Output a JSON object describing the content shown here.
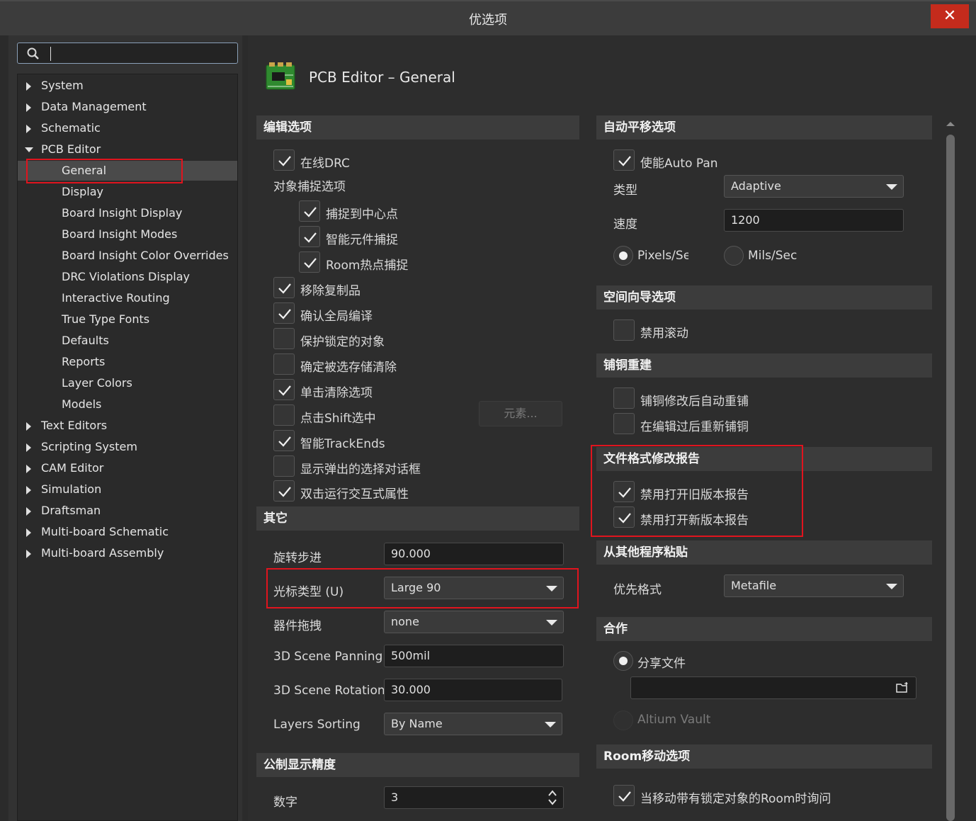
{
  "window": {
    "title": "优选项",
    "close_label": "✕"
  },
  "search": {
    "placeholder": ""
  },
  "tree": [
    {
      "label": "System",
      "expandable": true
    },
    {
      "label": "Data Management",
      "expandable": true
    },
    {
      "label": "Schematic",
      "expandable": true
    },
    {
      "label": "PCB Editor",
      "expanded": true
    },
    {
      "label": "General",
      "selected": true
    },
    {
      "label": "Display"
    },
    {
      "label": "Board Insight Display"
    },
    {
      "label": "Board Insight Modes"
    },
    {
      "label": "Board Insight Color Overrides"
    },
    {
      "label": "DRC Violations Display"
    },
    {
      "label": "Interactive Routing"
    },
    {
      "label": "True Type Fonts"
    },
    {
      "label": "Defaults"
    },
    {
      "label": "Reports"
    },
    {
      "label": "Layer Colors"
    },
    {
      "label": "Models"
    },
    {
      "label": "Text Editors",
      "expandable": true
    },
    {
      "label": "Scripting System",
      "expandable": true
    },
    {
      "label": "CAM Editor",
      "expandable": true
    },
    {
      "label": "Simulation",
      "expandable": true
    },
    {
      "label": "Draftsman",
      "expandable": true
    },
    {
      "label": "Multi-board Schematic",
      "expandable": true
    },
    {
      "label": "Multi-board Assembly",
      "expandable": true
    }
  ],
  "page": {
    "title": "PCB Editor – General"
  },
  "edit_options": {
    "heading": "编辑选项",
    "online_drc": {
      "label": "在线DRC",
      "checked": true
    },
    "snap_heading": "对象捕捉选项",
    "snap_center": {
      "label": "捕捉到中心点",
      "checked": true
    },
    "smart_component_snap": {
      "label": "智能元件捕捉",
      "checked": true
    },
    "room_hotspot": {
      "label": "Room热点捕捉",
      "checked": true
    },
    "remove_duplicates": {
      "label": "移除复制品",
      "checked": true
    },
    "confirm_global_edit": {
      "label": "确认全局编译",
      "checked": true
    },
    "protect_locked": {
      "label": "保护锁定的对象",
      "checked": false
    },
    "confirm_clear_selection": {
      "label": "确定被选存储清除",
      "checked": false
    },
    "click_clear_selection": {
      "label": "单击清除选项",
      "checked": true
    },
    "shift_click_select": {
      "label": "点击Shift选中",
      "checked": false
    },
    "elements_button": "元素...",
    "smart_track_ends": {
      "label": "智能TrackEnds",
      "checked": true
    },
    "show_popup_selection": {
      "label": "显示弹出的选择对话框",
      "checked": false
    },
    "double_click_inspector": {
      "label": "双击运行交互式属性",
      "checked": true
    }
  },
  "other": {
    "heading": "其它",
    "rotation_step": {
      "label": "旋转步进",
      "value": "90.000"
    },
    "cursor_type": {
      "label": "光标类型 (U)",
      "value": "Large 90"
    },
    "component_drag": {
      "label": "器件拖拽",
      "value": "none"
    },
    "scene_panning": {
      "label": "3D Scene Panning",
      "value": "500mil"
    },
    "scene_rotation": {
      "label": "3D Scene Rotation",
      "value": "30.000"
    },
    "layers_sorting": {
      "label": "Layers Sorting",
      "value": "By Name"
    }
  },
  "metric_precision": {
    "heading": "公制显示精度",
    "digits": {
      "label": "数字",
      "value": "3"
    }
  },
  "autopan": {
    "heading": "自动平移选项",
    "enable": {
      "label": "使能Auto Pan",
      "checked": true
    },
    "type": {
      "label": "类型",
      "value": "Adaptive"
    },
    "speed": {
      "label": "速度",
      "value": "1200"
    },
    "unit_pixels": {
      "label": "Pixels/Sec",
      "selected": true
    },
    "unit_mils": {
      "label": "Mils/Sec",
      "selected": false
    }
  },
  "space_navigator": {
    "heading": "空间向导选项",
    "disable_roll": {
      "label": "禁用滚动",
      "checked": false
    }
  },
  "polygon_rebuild": {
    "heading": "铺铜重建",
    "auto_rebuild": {
      "label": "铺铜修改后自动重铺",
      "checked": false
    },
    "repour_after_edit": {
      "label": "在编辑过后重新铺铜",
      "checked": false
    }
  },
  "file_format_report": {
    "heading": "文件格式修改报告",
    "disable_old": {
      "label": "禁用打开旧版本报告",
      "checked": true
    },
    "disable_new": {
      "label": "禁用打开新版本报告",
      "checked": true
    }
  },
  "paste_from_other": {
    "heading": "从其他程序粘贴",
    "preferred_format": {
      "label": "优先格式",
      "value": "Metafile"
    }
  },
  "collaboration": {
    "heading": "合作",
    "share_file": {
      "label": "分享文件",
      "selected": true
    },
    "path": "",
    "altium_vault": {
      "label": "Altium Vault",
      "selected": false
    }
  },
  "room_move": {
    "heading": "Room移动选项",
    "ask_locked": {
      "label": "当移动带有锁定对象的Room时询问",
      "checked": true
    }
  },
  "colors": {
    "highlight": "#e0141e",
    "close": "#c42b1c"
  }
}
